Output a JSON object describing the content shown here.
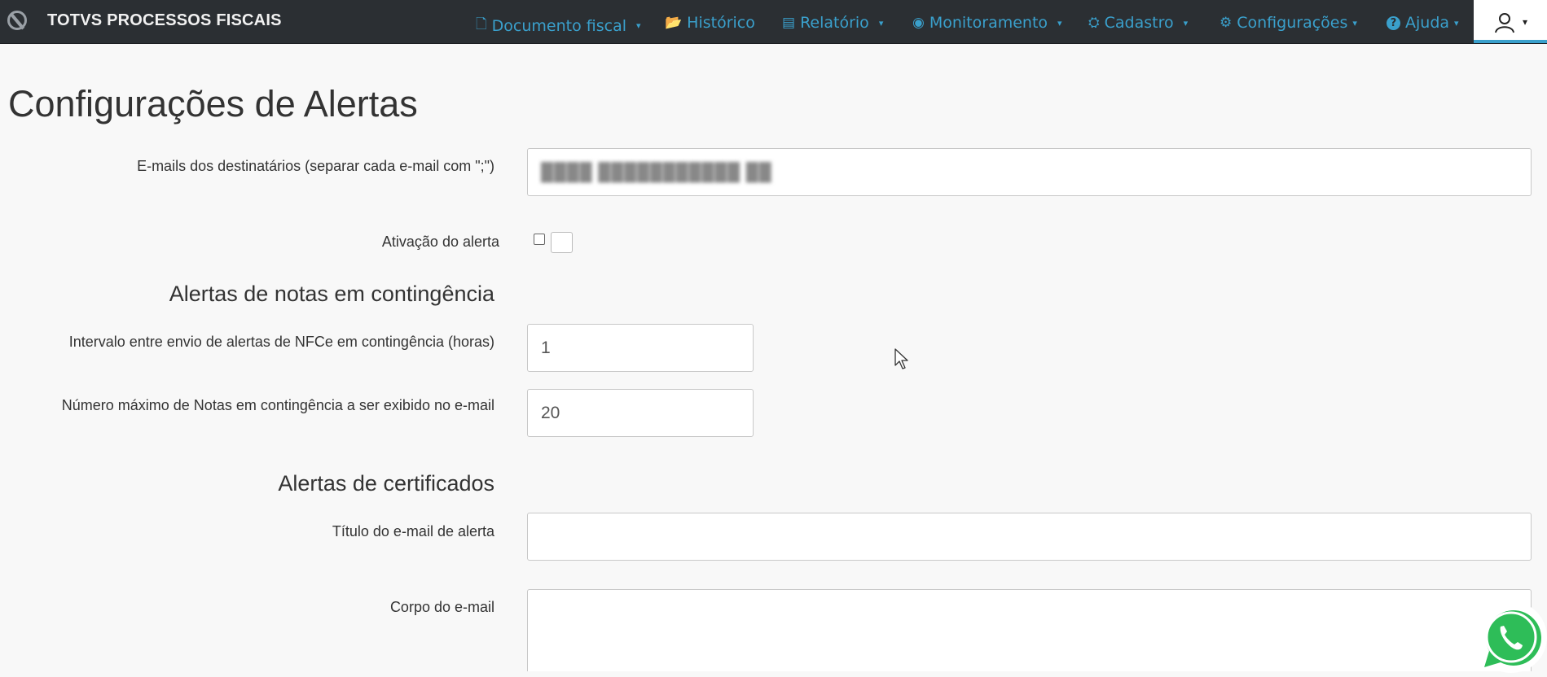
{
  "brand": {
    "title": "TOTVS PROCESSOS FISCAIS",
    "logo_icon": "totvs-logo-icon"
  },
  "nav": {
    "items": [
      {
        "label": "Documento fiscal",
        "icon": "document-icon",
        "glyph": "🗋",
        "has_caret": true
      },
      {
        "label": "Histórico",
        "icon": "folder-open-icon",
        "glyph": "📂",
        "has_caret": false
      },
      {
        "label": "Relatório",
        "icon": "list-icon",
        "glyph": "▤",
        "has_caret": true
      },
      {
        "label": "Monitoramento",
        "icon": "eye-icon",
        "glyph": "◉",
        "has_caret": true
      },
      {
        "label": "Cadastro",
        "icon": "stamp-icon",
        "glyph": "⛭",
        "has_caret": true
      },
      {
        "label": "Configurações",
        "icon": "gear-icon",
        "glyph": "⚙",
        "has_caret": true
      },
      {
        "label": "Ajuda",
        "icon": "question-icon",
        "glyph": "?",
        "has_caret": true
      }
    ],
    "caret": "▾",
    "accent_color": "#3aa0cc"
  },
  "page": {
    "title": "Configurações de Alertas"
  },
  "form": {
    "emails_label": "E-mails dos destinatários (separar cada e-mail com \";\")",
    "emails_value": "████ ███████████ ██",
    "activation_label": "Ativação do alerta",
    "activation_checked": false,
    "section_contingency": "Alertas de notas em contingência",
    "interval_label": "Intervalo entre envio de alertas de NFCe em contingência (horas)",
    "interval_value": "1",
    "max_notes_label": "Número máximo de Notas em contingência a ser exibido no e-mail",
    "max_notes_value": "20",
    "section_certificates": "Alertas de certificados",
    "email_title_label": "Título do e-mail de alerta",
    "email_title_value": "",
    "email_body_label": "Corpo do e-mail",
    "email_body_value": ""
  },
  "floating": {
    "whatsapp_icon": "whatsapp-icon"
  }
}
